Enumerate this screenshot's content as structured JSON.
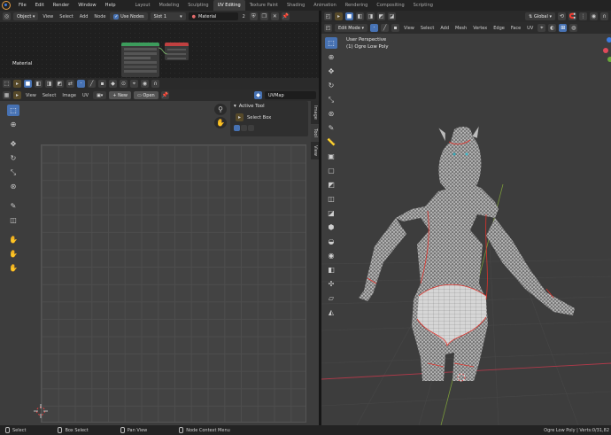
{
  "topbar": {
    "menus": [
      "File",
      "Edit",
      "Render",
      "Window",
      "Help"
    ],
    "workspaces": [
      "Layout",
      "Modeling",
      "Sculpting",
      "UV Editing",
      "Texture Paint",
      "Shading",
      "Animation",
      "Rendering",
      "Compositing",
      "Scripting"
    ],
    "active_workspace": "UV Editing"
  },
  "node_editor": {
    "mode": "Object",
    "menus": [
      "View",
      "Select",
      "Add",
      "Node"
    ],
    "use_nodes_label": "Use Nodes",
    "slot": "Slot 1",
    "material": "Material",
    "users": "2",
    "area_label": "Material"
  },
  "uv_editor": {
    "menus": [
      "View",
      "Select",
      "Image",
      "UV"
    ],
    "new_label": "New",
    "open_label": "Open",
    "uvmap": "UVMap",
    "active_tool_title": "Active Tool",
    "active_tool_name": "Select Box",
    "side_tabs": [
      "Image",
      "Tool",
      "View"
    ]
  },
  "viewport": {
    "mode": "Edit Mode",
    "transform": "Global",
    "menus": [
      "View",
      "Select",
      "Add",
      "Mesh",
      "Vertex",
      "Edge",
      "Face",
      "UV"
    ],
    "view_name": "User Perspective",
    "object_name": "(1) Ogre Low Poly"
  },
  "status": {
    "items": [
      "Select",
      "Box Select",
      "Pan View",
      "Node Context Menu"
    ],
    "right_text": "Ogre Low Poly | Verts:0/31,82"
  },
  "colors": {
    "accent": "#4772b3",
    "background": "#3d3d3d",
    "mesh": "#b9b9b9",
    "seam": "#e0322b"
  }
}
